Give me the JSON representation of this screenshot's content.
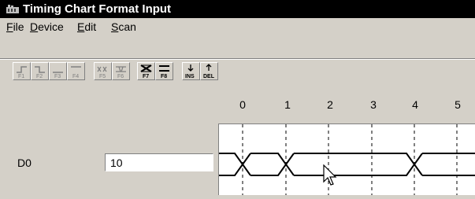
{
  "window": {
    "title": "Timing Chart Format Input"
  },
  "menu": [
    "File",
    "Device",
    "Edit",
    "Scan"
  ],
  "toolbar": {
    "buttons": [
      {
        "id": "f1",
        "label": "F1",
        "enabled": false
      },
      {
        "id": "f2",
        "label": "F2",
        "enabled": false
      },
      {
        "id": "f3",
        "label": "F3",
        "enabled": false
      },
      {
        "id": "f4",
        "label": "F4",
        "enabled": false
      },
      {
        "id": "f5",
        "label": "F5",
        "enabled": false
      },
      {
        "id": "f6",
        "label": "F6",
        "enabled": false
      },
      {
        "id": "f7",
        "label": "F7",
        "enabled": true
      },
      {
        "id": "f8",
        "label": "F8",
        "enabled": true
      },
      {
        "id": "ins",
        "label": "INS",
        "enabled": true
      },
      {
        "id": "del",
        "label": "DEL",
        "enabled": true
      }
    ]
  },
  "timeline": {
    "ticks": [
      "0",
      "1",
      "2",
      "3",
      "4",
      "5"
    ]
  },
  "signals": [
    {
      "name": "D0",
      "value": "10",
      "transitions_at": [
        0,
        1,
        4
      ]
    }
  ],
  "colors": {
    "titlebar": "#000000",
    "face": "#d4d0c8",
    "disabled": "#808080"
  }
}
